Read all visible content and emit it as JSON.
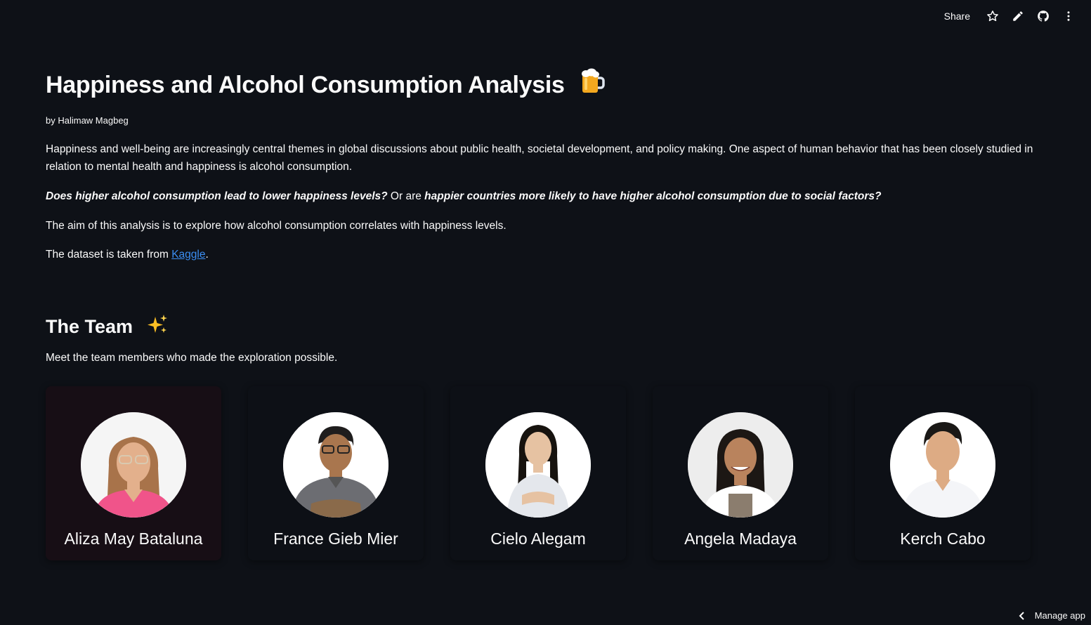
{
  "toolbar": {
    "share_label": "Share",
    "icons": [
      "star-icon",
      "pencil-icon",
      "github-icon",
      "more-vertical-icon"
    ]
  },
  "header": {
    "title": "Happiness and Alcohol Consumption Analysis",
    "title_emoji": "beer-mug-emoji",
    "byline": "by Halimaw Magbeg"
  },
  "intro": {
    "p1": "Happiness and well-being are increasingly central themes in global discussions about public health, societal development, and policy making. One aspect of human behavior that has been closely studied in relation to mental health and happiness is alcohol consumption.",
    "q1": "Does higher alcohol consumption lead to lower happiness levels?",
    "q_mid": " Or are ",
    "q2": "happier countries more likely to have higher alcohol consumption due to social factors?",
    "aim": "The aim of this analysis is to explore how alcohol consumption correlates with happiness levels.",
    "dataset_prefix": "The dataset is taken from ",
    "dataset_link": "Kaggle",
    "dataset_suffix": "."
  },
  "team": {
    "title": "The Team",
    "title_emoji": "sparkles-emoji",
    "subtitle": "Meet the team members who made the exploration possible.",
    "members": [
      {
        "name": "Aliza May Bataluna"
      },
      {
        "name": "France Gieb Mier"
      },
      {
        "name": "Cielo Alegam"
      },
      {
        "name": "Angela Madaya"
      },
      {
        "name": "Kerch Cabo"
      }
    ]
  },
  "footer": {
    "manage_label": "Manage app"
  },
  "colors": {
    "background": "#0e1117",
    "text": "#fafafa",
    "link": "#3b8ef3",
    "active_card": "#170e15"
  }
}
